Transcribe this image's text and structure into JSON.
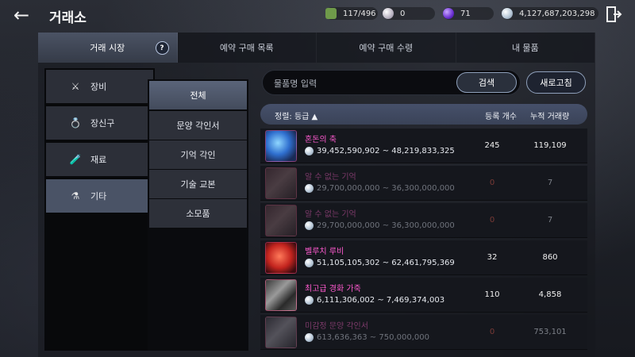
{
  "header": {
    "back_icon": "arrow-left-icon",
    "title": "거래소",
    "resources": [
      {
        "icon": "bag-icon",
        "value": "117/496"
      },
      {
        "icon": "pearl-icon",
        "value": "0"
      },
      {
        "icon": "orb-icon",
        "value": "71"
      },
      {
        "icon": "silver-icon",
        "value": "4,127,687,203,298"
      }
    ],
    "exit_icon": "exit-door-icon"
  },
  "tabs": [
    {
      "label": "거래 시장",
      "active": true
    },
    {
      "label": "예약 구매 목록",
      "active": false
    },
    {
      "label": "예약 구매 수령",
      "active": false
    },
    {
      "label": "내 물품",
      "active": false
    }
  ],
  "help_label": "?",
  "categories": [
    {
      "label": "장비",
      "icon": "crossed-swords-icon",
      "glyph": "⚔"
    },
    {
      "label": "장신구",
      "icon": "ring-icon",
      "glyph": "💍"
    },
    {
      "label": "재료",
      "icon": "potion-bottle-icon",
      "glyph": "🧪"
    },
    {
      "label": "기타",
      "icon": "flask-icon",
      "glyph": "⚗",
      "active": true
    }
  ],
  "subcategories": [
    {
      "label": "전체",
      "active": true
    },
    {
      "label": "문양 각인서"
    },
    {
      "label": "기억 각인"
    },
    {
      "label": "기술 교본"
    },
    {
      "label": "소모품"
    }
  ],
  "search": {
    "placeholder": "물품명 입력",
    "button_label": "검색",
    "refresh_label": "새로고침"
  },
  "table": {
    "sort_label": "정렬: 등급 ▲",
    "col_count": "등록 개수",
    "col_volume": "누적 거래량",
    "rows": [
      {
        "name": "혼돈의 축",
        "price": "39,452,590,902 ~ 48,219,833,325",
        "count": "245",
        "volume": "119,109",
        "dim": false
      },
      {
        "name": "알 수 없는 기억",
        "price": "29,700,000,000 ~ 36,300,000,000",
        "count": "0",
        "volume": "7",
        "dim": true
      },
      {
        "name": "알 수 없는 기억",
        "price": "29,700,000,000 ~ 36,300,000,000",
        "count": "0",
        "volume": "7",
        "dim": true
      },
      {
        "name": "벨루치 루비",
        "price": "51,105,105,302 ~ 62,461,795,369",
        "count": "32",
        "volume": "860",
        "dim": false
      },
      {
        "name": "최고급 경화 가죽",
        "price": "6,111,306,002 ~ 7,469,374,003",
        "count": "110",
        "volume": "4,858",
        "dim": false
      },
      {
        "name": "미감정 문양 각인서",
        "price": "613,636,363 ~ 750,000,000",
        "count": "0",
        "volume": "753,101",
        "dim": true
      }
    ]
  }
}
